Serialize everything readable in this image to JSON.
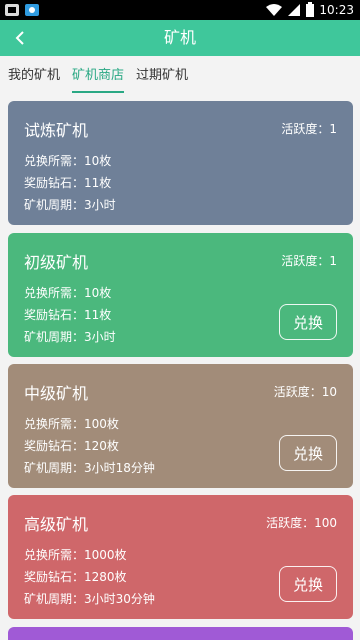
{
  "status_bar": {
    "time": "10:23"
  },
  "app_bar": {
    "title": "矿机"
  },
  "tabs": [
    {
      "label": "我的矿机"
    },
    {
      "label": "矿机商店"
    },
    {
      "label": "过期矿机"
    }
  ],
  "colors": {
    "accent": "#3fc79b",
    "tab_active": "#2aa884"
  },
  "cards": [
    {
      "title": "试炼矿机",
      "activity": "活跃度：1",
      "lines": [
        "兑换所需：10枚",
        "奖励钻石：11枚",
        "矿机周期：3小时"
      ],
      "button": "",
      "color": "#6f8098"
    },
    {
      "title": "初级矿机",
      "activity": "活跃度：1",
      "lines": [
        "兑换所需：10枚",
        "奖励钻石：11枚",
        "矿机周期：3小时"
      ],
      "button": "兑换",
      "color": "#4bb87d"
    },
    {
      "title": "中级矿机",
      "activity": "活跃度：10",
      "lines": [
        "兑换所需：100枚",
        "奖励钻石：120枚",
        "矿机周期：3小时18分钟"
      ],
      "button": "兑换",
      "color": "#a28c79"
    },
    {
      "title": "高级矿机",
      "activity": "活跃度：100",
      "lines": [
        "兑换所需：1000枚",
        "奖励钻石：1280枚",
        "矿机周期：3小时30分钟"
      ],
      "button": "兑换",
      "color": "#cf676a"
    },
    {
      "title": "",
      "activity": "",
      "lines": [],
      "button": "",
      "color": "#a05ad6"
    }
  ]
}
